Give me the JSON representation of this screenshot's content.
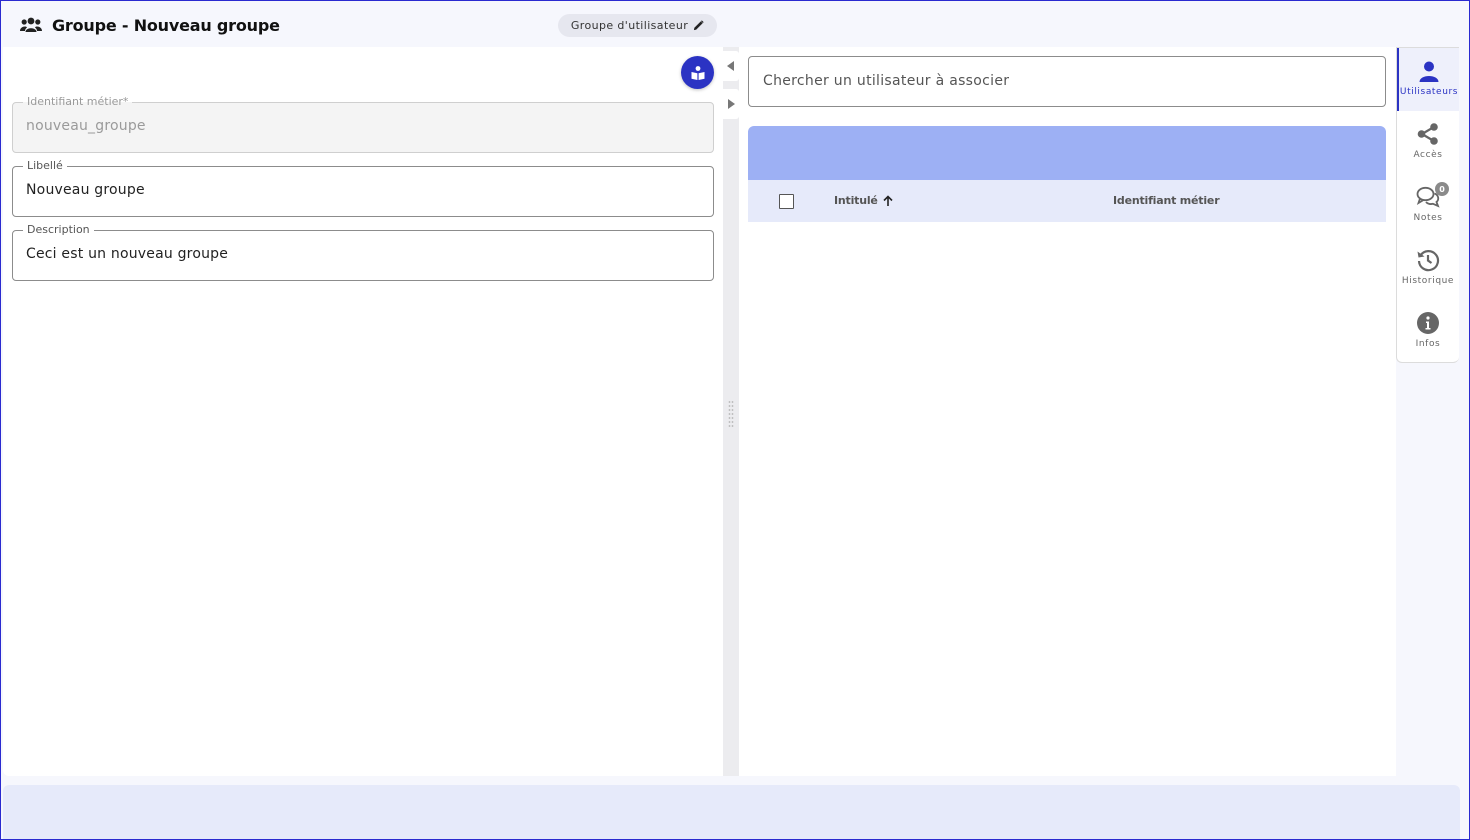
{
  "header": {
    "title": "Groupe - Nouveau groupe",
    "title_icon": "users-icon",
    "type_chip": "Groupe d'utilisateur",
    "type_chip_icon": "pencil-icon"
  },
  "form": {
    "help_icon": "book-reader-icon",
    "identifier": {
      "label": "Identifiant métier*",
      "value": "nouveau_groupe",
      "disabled": true
    },
    "libelle": {
      "label": "Libellé",
      "value": "Nouveau groupe"
    },
    "description": {
      "label": "Description",
      "value": "Ceci est un nouveau groupe"
    }
  },
  "users": {
    "search_placeholder": "Chercher un utilisateur à associer",
    "columns": {
      "title": "Intitulé",
      "title_sort": "ascending",
      "identifier": "Identifiant métier"
    },
    "rows": []
  },
  "side_nav": {
    "items": [
      {
        "label": "Utilisateurs",
        "icon": "user-icon",
        "active": true
      },
      {
        "label": "Accès",
        "icon": "share-icon"
      },
      {
        "label": "Notes",
        "icon": "comments-icon",
        "badge": "0"
      },
      {
        "label": "Historique",
        "icon": "history-icon"
      },
      {
        "label": "Infos",
        "icon": "info-icon"
      }
    ]
  },
  "colors": {
    "accent": "#2b33c3",
    "table_toolbar": "#9db0f4",
    "table_header": "#e6eafa",
    "background": "#f6f7fd"
  }
}
